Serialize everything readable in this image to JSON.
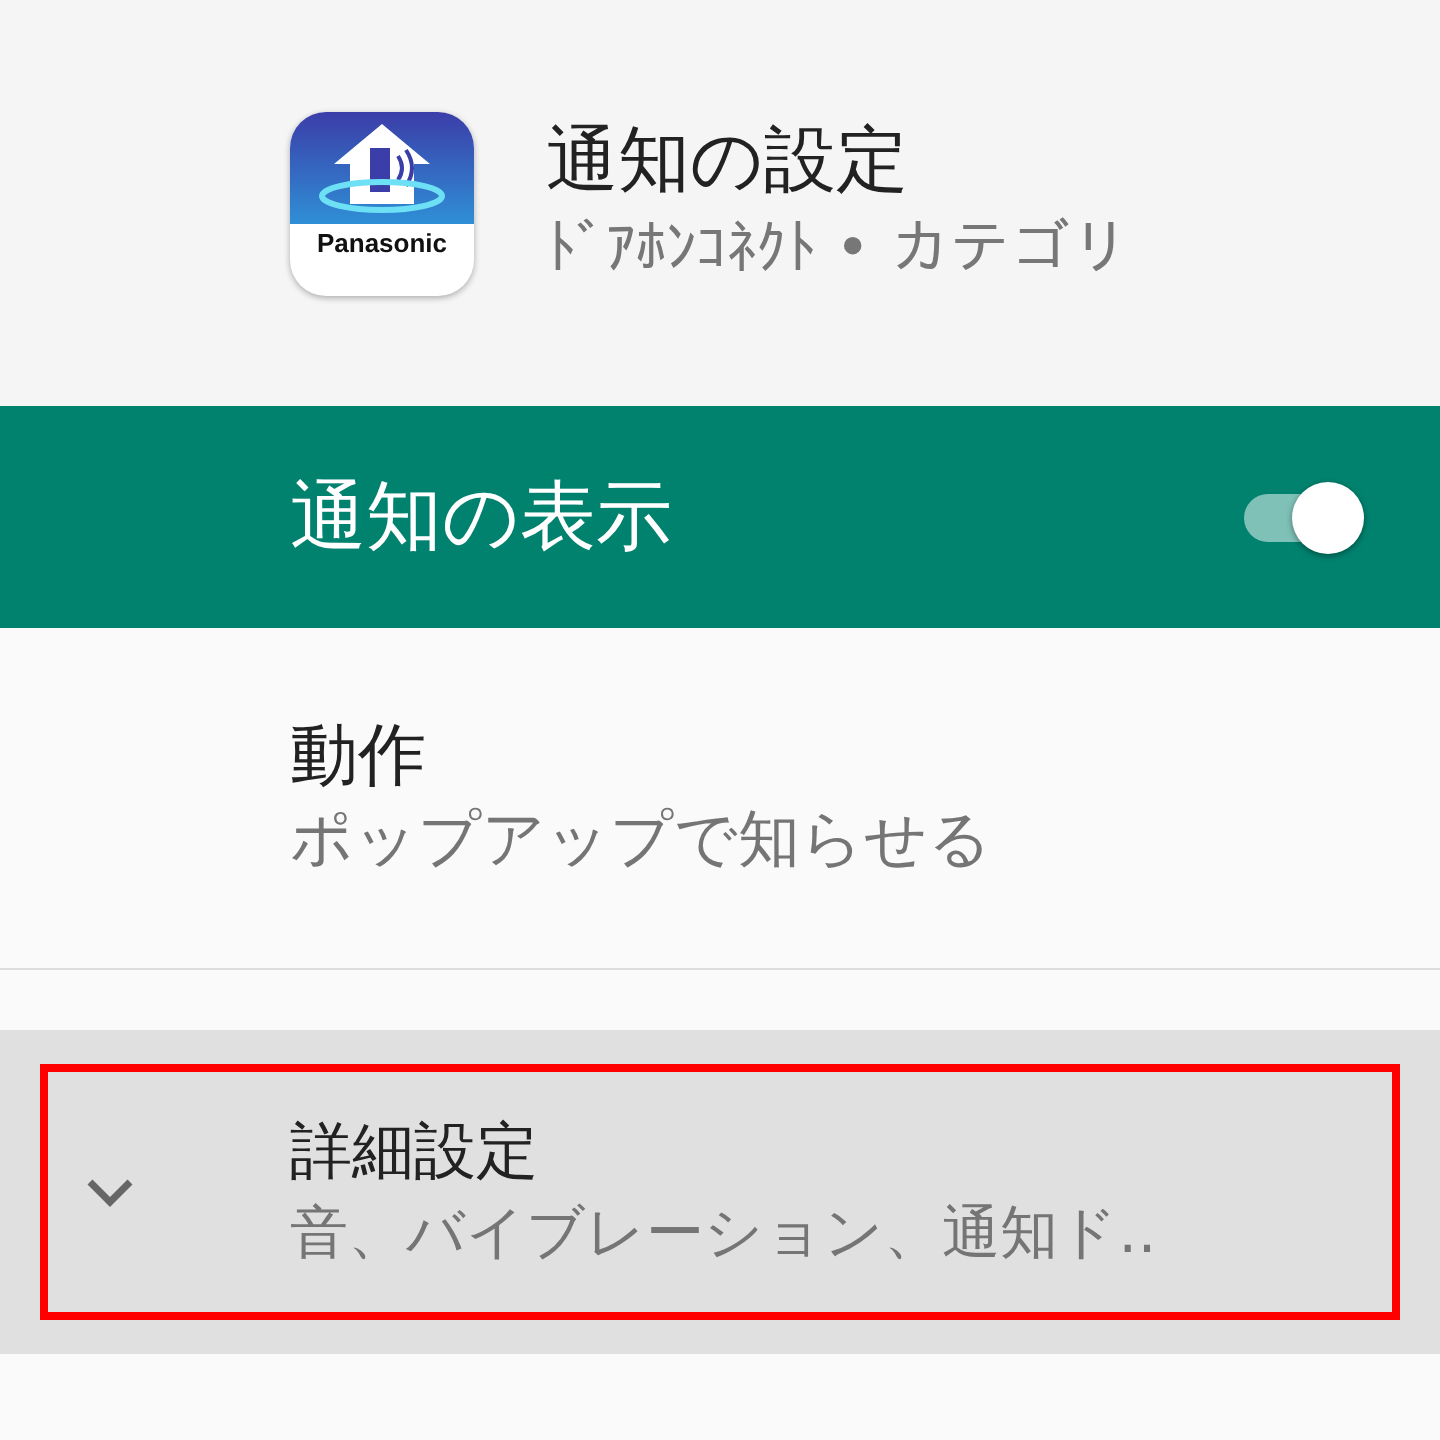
{
  "header": {
    "app_icon_label": "Panasonic",
    "title": "通知の設定",
    "subtitle": "ﾄﾞｱﾎﾝｺﾈｸﾄ • カテゴリ"
  },
  "master_switch": {
    "label": "通知の表示",
    "on": true
  },
  "items": [
    {
      "kind": "plain",
      "title": "動作",
      "summary": "ポップアップで知らせる",
      "highlighted": false
    },
    {
      "kind": "expander",
      "title": "詳細設定",
      "summary": "音、バイブレーション、通知ド‥",
      "expanded": false,
      "highlighted": true
    }
  ]
}
